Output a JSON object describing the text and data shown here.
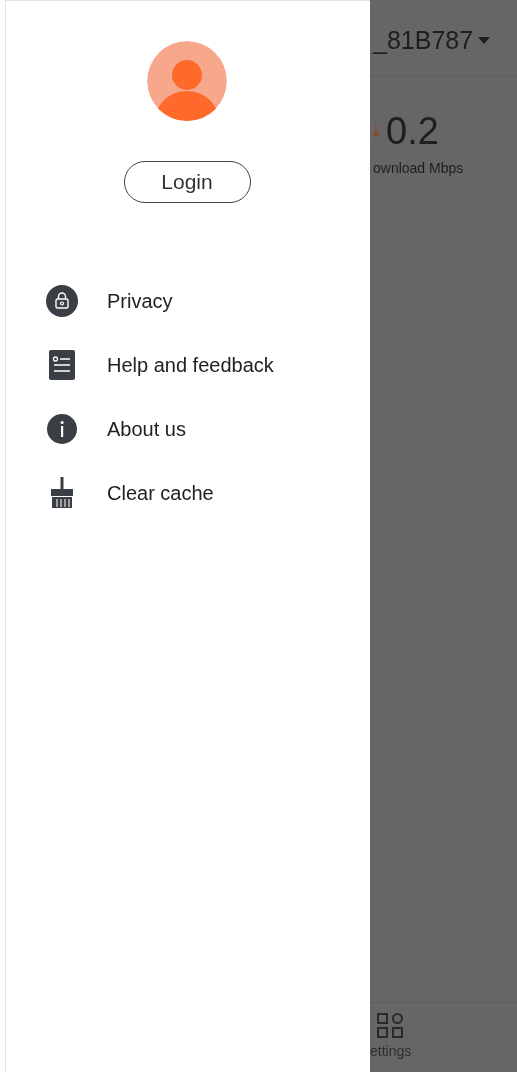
{
  "drawer": {
    "login_button": "Login",
    "menu": [
      {
        "kind": "privacy",
        "label": "Privacy"
      },
      {
        "kind": "help",
        "label": "Help and feedback"
      },
      {
        "kind": "about",
        "label": "About us"
      },
      {
        "kind": "cache",
        "label": "Clear cache"
      }
    ]
  },
  "background": {
    "network_name": "_81B787",
    "download_value": "0.2",
    "download_label": "ownload Mbps",
    "tab_label": "ettings"
  }
}
